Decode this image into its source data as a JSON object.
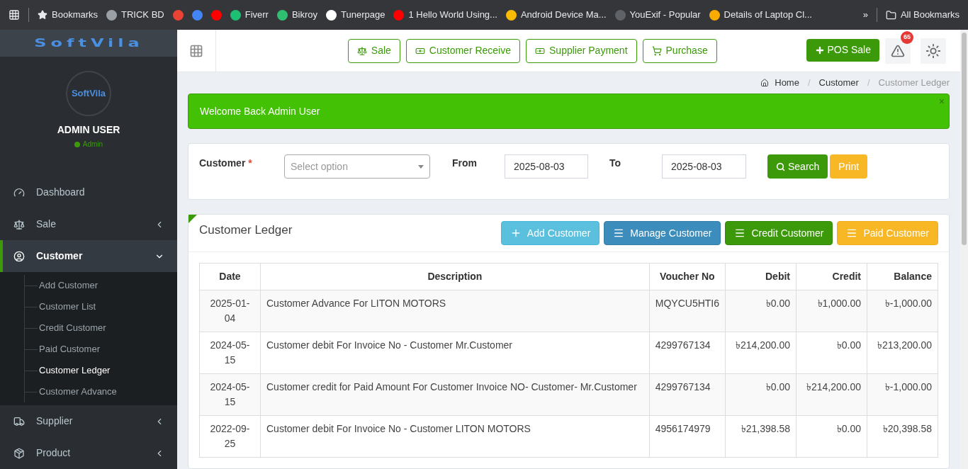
{
  "bookmarks_bar": {
    "items": [
      {
        "kind": "link",
        "label": "Bookmarks"
      },
      {
        "kind": "link",
        "label": "TRICK BD"
      },
      {
        "kind": "icon"
      },
      {
        "kind": "icon"
      },
      {
        "kind": "icon"
      },
      {
        "kind": "link",
        "label": "Fiverr"
      },
      {
        "kind": "link",
        "label": "Bikroy"
      },
      {
        "kind": "link",
        "label": "Tunerpage"
      },
      {
        "kind": "link",
        "label": "1 Hello World Using..."
      },
      {
        "kind": "link",
        "label": "Android Device Ma..."
      },
      {
        "kind": "link",
        "label": "YouExif - Popular"
      },
      {
        "kind": "link",
        "label": "Details of Laptop Cl..."
      }
    ],
    "overflow": "»",
    "all": "All Bookmarks"
  },
  "sidebar": {
    "logo": "SoftVila",
    "avatar": "SoftVila",
    "user_name": "ADMIN USER",
    "role": "Admin",
    "items": [
      {
        "label": "Dashboard",
        "kind": "plain",
        "selected": false
      },
      {
        "label": "Sale",
        "kind": "group",
        "expanded": false,
        "selected": false
      },
      {
        "label": "Customer",
        "kind": "group",
        "expanded": true,
        "selected": true,
        "children": [
          {
            "label": "Add Customer",
            "selected": false
          },
          {
            "label": "Customer List",
            "selected": false
          },
          {
            "label": "Credit Customer",
            "selected": false
          },
          {
            "label": "Paid Customer",
            "selected": false
          },
          {
            "label": "Customer Ledger",
            "selected": true
          },
          {
            "label": "Customer Advance",
            "selected": false
          }
        ]
      },
      {
        "label": "Supplier",
        "kind": "group",
        "expanded": false,
        "selected": false
      },
      {
        "label": "Product",
        "kind": "group",
        "expanded": false,
        "selected": false
      }
    ]
  },
  "header": {
    "quick_buttons": [
      "Sale",
      "Customer Receive",
      "Supplier Payment",
      "Purchase"
    ],
    "pos_button": "POS Sale",
    "notification_count": "65"
  },
  "breadcrumb": {
    "separator": "/",
    "items": [
      "Home",
      "Customer",
      "Customer Ledger"
    ]
  },
  "alert": {
    "text": "Welcome Back Admin User",
    "close": "×"
  },
  "filter": {
    "customer_label": "Customer",
    "required_mark": "*",
    "customer_placeholder": "Select option",
    "from_label": "From",
    "from_value": "2025-08-03",
    "to_label": "To",
    "to_value": "2025-08-03",
    "search": "Search",
    "print": "Print"
  },
  "ledger": {
    "title": "Customer Ledger",
    "actions": [
      {
        "label": "Add Customer",
        "kind": "add"
      },
      {
        "label": "Manage Customer",
        "kind": "manage"
      },
      {
        "label": "Credit Customer",
        "kind": "credit"
      },
      {
        "label": "Paid Customer",
        "kind": "paid"
      }
    ],
    "columns": [
      "Date",
      "Description",
      "Voucher No",
      "Debit",
      "Credit",
      "Balance"
    ],
    "rows": [
      [
        "2025-01-04",
        "Customer Advance For LITON MOTORS",
        "MQYCU5HTI6",
        "৳0.00",
        "৳1,000.00",
        "৳-1,000.00"
      ],
      [
        "2024-05-15",
        "Customer debit For Invoice No - Customer Mr.Customer",
        "4299767134",
        "৳214,200.00",
        "৳0.00",
        "৳213,200.00"
      ],
      [
        "2024-05-15",
        "Customer credit for Paid Amount For Customer Invoice NO- Customer- Mr.Customer",
        "4299767134",
        "৳0.00",
        "৳214,200.00",
        "৳-1,000.00"
      ],
      [
        "2022-09-25",
        "Customer debit For Invoice No - Customer LITON MOTORS",
        "4956174979",
        "৳21,398.58",
        "৳0.00",
        "৳20,398.58"
      ]
    ]
  }
}
